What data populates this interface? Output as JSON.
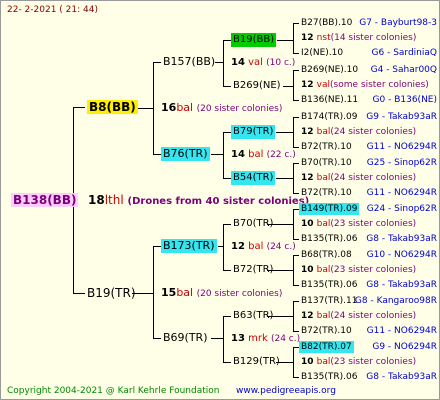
{
  "header": {
    "date": "22-  2-2021 ( 21: 44)"
  },
  "footer": {
    "copyright": "Copyright 2004-2021 @ Karl Kehrle Foundation",
    "website": "www.pedigreeapis.org"
  },
  "root": {
    "name": "B138(BB)"
  },
  "gen1_center": {
    "num": "18",
    "code": "lthl",
    "note": "(Drones from 40 sister colonies)"
  },
  "gen1": {
    "mother": {
      "name": "B8(BB)"
    },
    "father": {
      "name": "B19(TR)"
    }
  },
  "gen2": {
    "top_center": {
      "num": "16",
      "code": "bal",
      "note": "(20 sister colonies)"
    },
    "bottom_center": {
      "num": "15",
      "code": "bal",
      "note": "(20 sister colonies)"
    },
    "a": "B157(BB)",
    "b": "B76(TR)",
    "c": "B173(TR)",
    "d": "B69(TR)"
  },
  "gen3": {
    "n1": {
      "name": "B19(BB)",
      "num": "14",
      "code": "val",
      "note": "(10 c.)"
    },
    "n2": {
      "name": "B269(NE)"
    },
    "n3": {
      "name": "B79(TR)",
      "num": "14",
      "code": "bal",
      "note": "(22 c.)"
    },
    "n4": {
      "name": "B54(TR)"
    },
    "n5": {
      "name": "B70(TR)",
      "num": "12",
      "code": "bal",
      "note": "(24 c.)"
    },
    "n6": {
      "name": "B72(TR)"
    },
    "n7": {
      "name": "B63(TR)",
      "num": "13",
      "code": "mrk",
      "note": "(24 c.)"
    },
    "n8": {
      "name": "B129(TR)"
    }
  },
  "gen4": [
    {
      "name": "B27(BB).10",
      "ref": "G7 - Bayburt98-3"
    },
    {
      "num": "12",
      "code": "nst",
      "note": "(14 sister colonies)"
    },
    {
      "name": "I2(NE).10",
      "ref": "G6 - SardiniaQ"
    },
    {
      "name": "B269(NE).10",
      "ref": "G4 - Sahar00Q"
    },
    {
      "num": "12",
      "code": "val",
      "note": "(some sister colonies)"
    },
    {
      "name": "B136(NE).11",
      "ref": "G0 - B136(NE)"
    },
    {
      "name": "B174(TR).09",
      "ref": "G9 - Takab93aR"
    },
    {
      "num": "12",
      "code": "bal",
      "note": "(24 sister colonies)"
    },
    {
      "name": "B72(TR).10",
      "ref": "G11 - NO6294R"
    },
    {
      "name": "B70(TR).10",
      "ref": "G25 - Sinop62R"
    },
    {
      "num": "12",
      "code": "bal",
      "note": "(24 sister colonies)"
    },
    {
      "name": "B72(TR).10",
      "ref": "G11 - NO6294R"
    },
    {
      "name": "B149(TR).09",
      "ref": "G24 - Sinop62R"
    },
    {
      "num": "10",
      "code": "bal",
      "note": "(23 sister colonies)"
    },
    {
      "name": "B135(TR).06",
      "ref": "G8 - Takab93aR"
    },
    {
      "name": "B68(TR).08",
      "ref": "G10 - NO6294R"
    },
    {
      "num": "10",
      "code": "bal",
      "note": "(23 sister colonies)"
    },
    {
      "name": "B135(TR).06",
      "ref": "G8 - Takab93aR"
    },
    {
      "name": "B137(TR).11",
      "ref": "G8 - Kangaroo98R"
    },
    {
      "num": "12",
      "code": "bal",
      "note": "(24 sister colonies)"
    },
    {
      "name": "B72(TR).10",
      "ref": "G11 - NO6294R"
    },
    {
      "name": "B82(TR).07",
      "ref": "G9 - NO6294R"
    },
    {
      "num": "10",
      "code": "bal",
      "note": "(23 sister colonies)"
    },
    {
      "name": "B135(TR).06",
      "ref": "G8 - Takab93aR"
    }
  ]
}
